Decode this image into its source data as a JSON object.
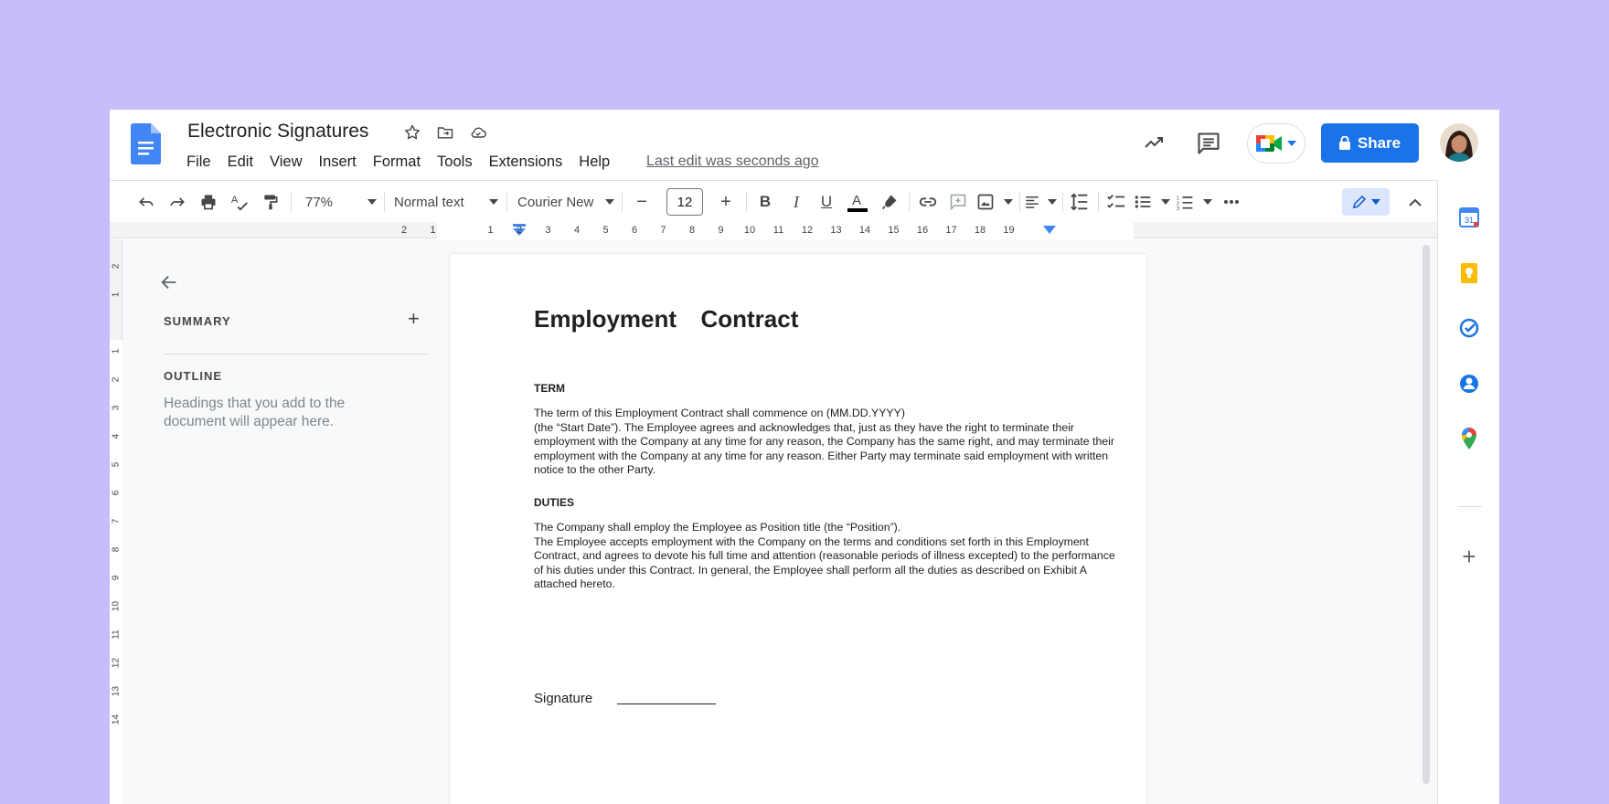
{
  "document": {
    "title": "Electronic Signatures",
    "last_edit": "Last edit was seconds ago"
  },
  "menu": [
    "File",
    "Edit",
    "View",
    "Insert",
    "Format",
    "Tools",
    "Extensions",
    "Help"
  ],
  "header": {
    "share_label": "Share"
  },
  "toolbar": {
    "zoom": "77%",
    "style": "Normal text",
    "font": "Courier New",
    "font_size": "12",
    "decrease_label": "−",
    "increase_label": "+"
  },
  "ruler": {
    "horizontal": [
      "2",
      "1",
      "1",
      "2",
      "3",
      "4",
      "5",
      "6",
      "7",
      "8",
      "9",
      "10",
      "11",
      "12",
      "13",
      "14",
      "15",
      "16",
      "17",
      "18",
      "19"
    ],
    "vertical": [
      "2",
      "1",
      "1",
      "2",
      "3",
      "4",
      "5",
      "6",
      "7",
      "8",
      "9",
      "10",
      "11",
      "12",
      "13",
      "14"
    ]
  },
  "sidebar": {
    "summary": "SUMMARY",
    "outline": "OUTLINE",
    "hint": "Headings that you add to the document will appear here."
  },
  "page": {
    "heading": "Employment  Contract",
    "term_title": "TERM",
    "term_body": "The term of this Employment Contract shall commence on (MM.DD.YYYY)\n(the “Start Date”). The Employee agrees and acknowledges that, just as they have the right to terminate their employment with the Company at any time for any reason, the Company has the same right, and may terminate their employment with the Company at any time for any reason. Either Party may terminate said employment with written notice to the other Party.",
    "duties_title": "DUTIES",
    "duties_body": "The Company shall employ the Employee as Position title (the “Position”).\nThe Employee accepts employment with the Company on the terms and conditions set forth in this Employment Contract, and agrees to devote his full time and attention (reasonable periods of illness excepted) to the performance of his duties under this Contract. In general, the Employee shall perform all the duties as described on Exhibit A attached hereto.",
    "signature_label": "Signature"
  },
  "side_panel": {
    "calendar_day": "31"
  },
  "colors": {
    "background": "#c5bdfc",
    "accent": "#1a73e8",
    "keep_yellow": "#fbbc04"
  }
}
